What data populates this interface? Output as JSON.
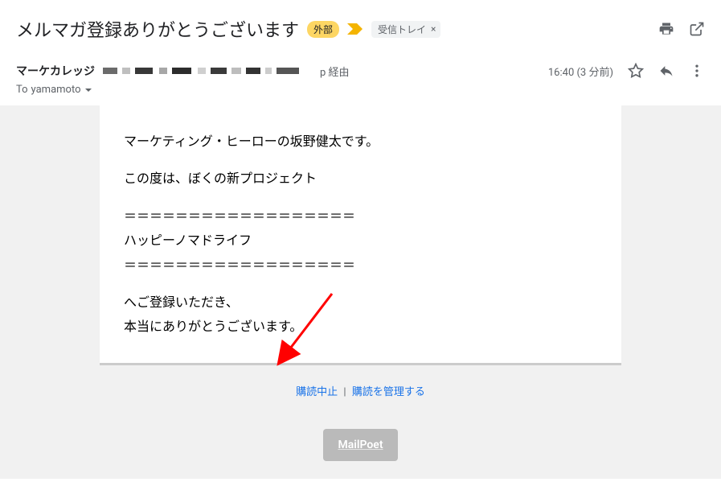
{
  "header": {
    "subject": "メルマガ登録ありがとうございます",
    "external_badge": "外部",
    "inbox_label": "受信トレイ"
  },
  "sender": {
    "name": "マーケカレッジ",
    "via_suffix": "p 経由",
    "to_prefix": "To",
    "to_name": "yamamoto",
    "time": "16:40",
    "relative": "(3 分前)"
  },
  "body": {
    "line1": "マーケティング・ヒーローの坂野健太です。",
    "line2": "この度は、ぼくの新プロジェクト",
    "divider": "＝＝＝＝＝＝＝＝＝＝＝＝＝＝＝＝＝＝",
    "title": "ハッピーノマドライフ",
    "line3": "へご登録いただき、",
    "line4": "本当にありがとうございます。"
  },
  "footer": {
    "unsubscribe": "購読中止",
    "separator": "|",
    "manage": "購読を管理する",
    "mailpoet": "MailPoet"
  }
}
